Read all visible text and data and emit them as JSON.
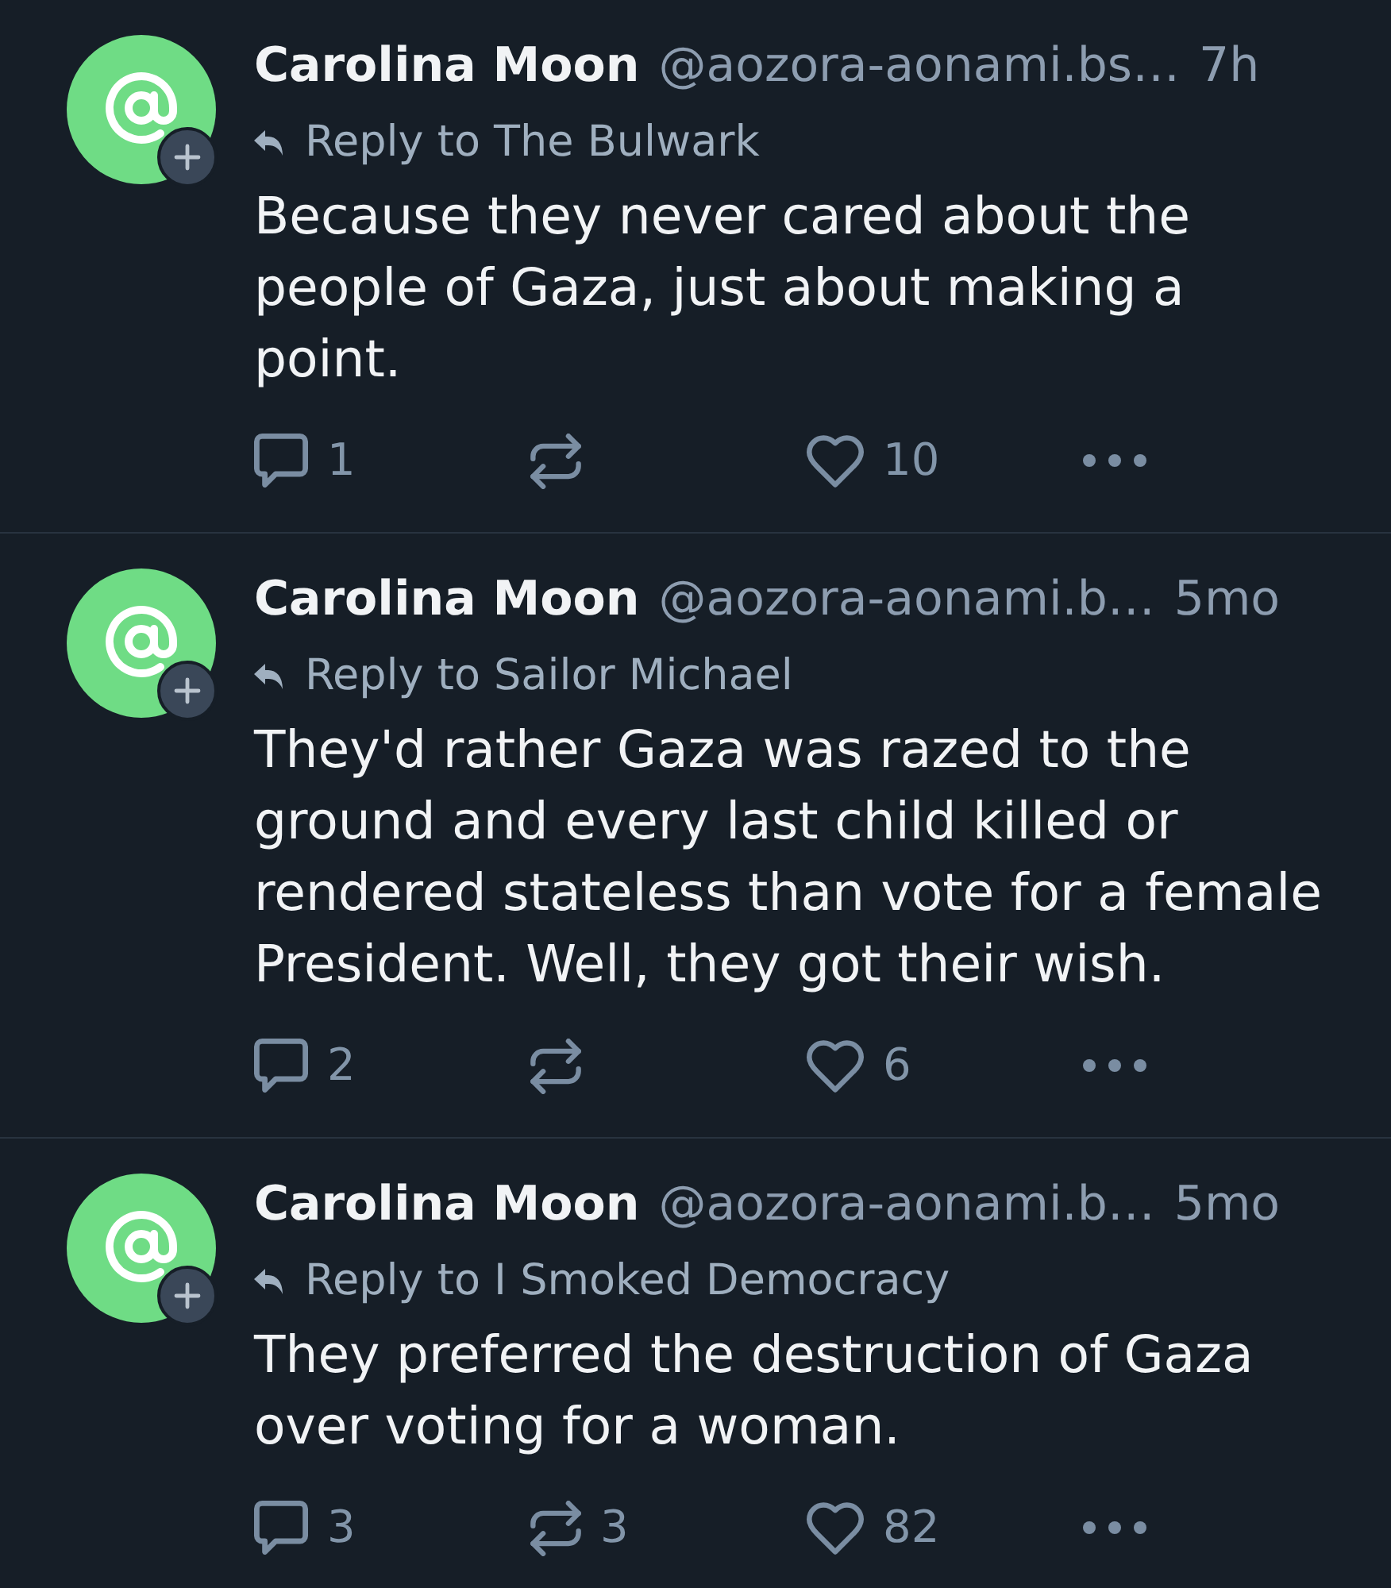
{
  "posts": [
    {
      "author": "Carolina Moon",
      "handle": "@aozora-aonami.bs…",
      "time": "7h",
      "reply_to": "Reply to The Bulwark",
      "text": "Because they never cared about the people of Gaza, just about making a point.",
      "actions": [
        {
          "kind": "reply",
          "count": "1"
        },
        {
          "kind": "repost"
        },
        {
          "kind": "like",
          "count": "10"
        },
        {
          "kind": "more"
        }
      ]
    },
    {
      "author": "Carolina Moon",
      "handle": "@aozora-aonami.b…",
      "time": "5mo",
      "reply_to": "Reply to Sailor Michael",
      "text": "They'd rather Gaza was razed to the ground and every last child killed or rendered stateless than vote for a female President. Well, they got their wish.",
      "actions": [
        {
          "kind": "reply",
          "count": "2"
        },
        {
          "kind": "repost"
        },
        {
          "kind": "like",
          "count": "6"
        },
        {
          "kind": "more"
        }
      ]
    },
    {
      "author": "Carolina Moon",
      "handle": "@aozora-aonami.b…",
      "time": "5mo",
      "reply_to": "Reply to I Smoked Democracy",
      "text": "They preferred the destruction of Gaza over voting for a woman.",
      "actions": [
        {
          "kind": "reply",
          "count": "3"
        },
        {
          "kind": "repost",
          "count": "3"
        },
        {
          "kind": "like",
          "count": "82"
        },
        {
          "kind": "more"
        }
      ]
    }
  ]
}
